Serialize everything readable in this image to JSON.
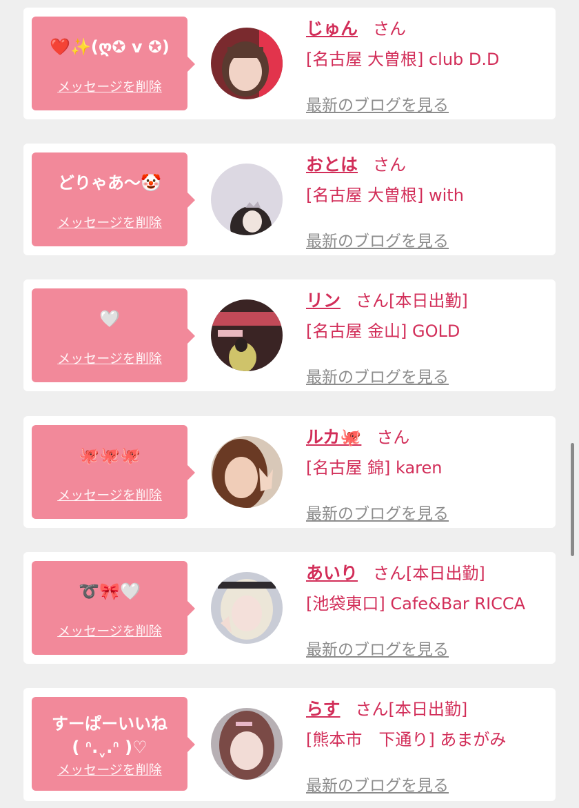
{
  "colors": {
    "page_bg": "#efefef",
    "card_bg": "#ffffff",
    "bubble_bg": "#f2899a",
    "accent": "#d22e59",
    "link_gray": "#8c8c8c"
  },
  "cards": [
    {
      "message": "❤️✨(ღ✪ v ✪)",
      "delete_label": "メッセージを削除",
      "name": "じゅん",
      "suffix": "さん",
      "shop": "[名古屋 大曽根] club D.D",
      "blog_label": "最新のブログを見る",
      "avatar_icon": "avatar-photo-junn"
    },
    {
      "message": "どりゃあ〜🤡",
      "delete_label": "メッセージを削除",
      "name": "おとは",
      "suffix": "さん",
      "shop": "[名古屋 大曽根] with",
      "blog_label": "最新のブログを見る",
      "avatar_icon": "avatar-photo-otoha"
    },
    {
      "message": "🤍",
      "delete_label": "メッセージを削除",
      "name": "リン",
      "suffix": "さん[本日出勤]",
      "shop": "[名古屋 金山] GOLD",
      "blog_label": "最新のブログを見る",
      "avatar_icon": "avatar-photo-rin"
    },
    {
      "message": "🐙🐙🐙",
      "delete_label": "メッセージを削除",
      "name": "ルカ🐙",
      "suffix": "さん",
      "shop": "[名古屋 錦] karen",
      "blog_label": "最新のブログを見る",
      "avatar_icon": "avatar-photo-ruka"
    },
    {
      "message": "➰🎀🤍",
      "delete_label": "メッセージを削除",
      "name": "あいり",
      "suffix": "さん[本日出勤]",
      "shop": "[池袋東口] Cafe&Bar RICCA",
      "blog_label": "最新のブログを見る",
      "avatar_icon": "avatar-photo-airi"
    },
    {
      "message": "すーぱーいいね\n( ᐢ.ˬ.ᐢ )♡",
      "delete_label": "メッセージを削除",
      "name": "らす",
      "suffix": "さん[本日出勤]",
      "shop": "[熊本市　下通り] あまがみ",
      "blog_label": "最新のブログを見る",
      "avatar_icon": "avatar-photo-rasu"
    }
  ]
}
